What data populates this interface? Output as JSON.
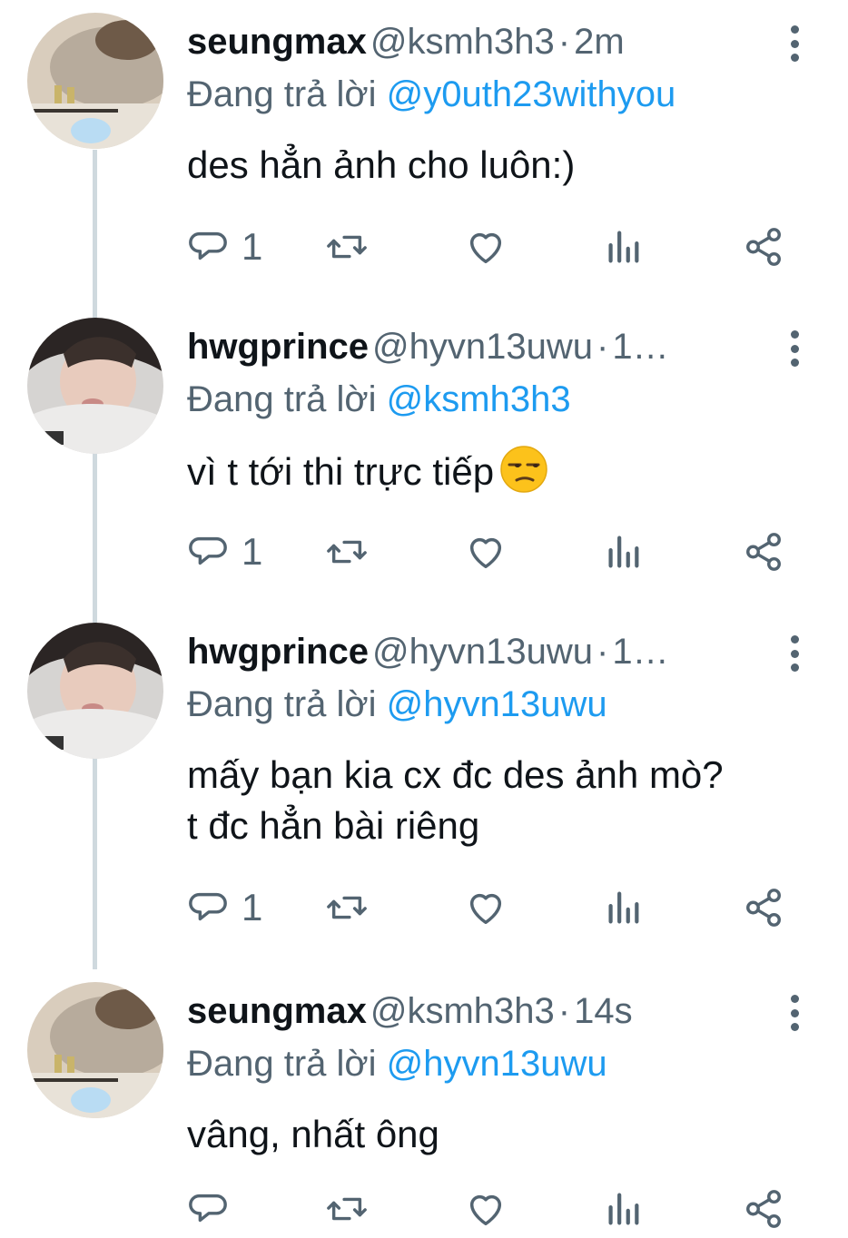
{
  "tweets": [
    {
      "name": "seungmax",
      "handle": "@ksmh3h3",
      "separator": "·",
      "time": "2m",
      "reply_prefix": "Đang trả lời",
      "reply_to": "@y0uth23withyou",
      "text_lines": [
        "des hẳn ảnh cho luôn:)"
      ],
      "reply_count": "1"
    },
    {
      "name": "hwgprince",
      "handle": "@hyvn13uwu",
      "separator": "·",
      "time": "1…",
      "reply_prefix": "Đang trả lời",
      "reply_to": "@ksmh3h3",
      "text_lines": [
        "vì t tới thi trực tiếp"
      ],
      "emoji": "unamused-face-emoji",
      "reply_count": "1"
    },
    {
      "name": "hwgprince",
      "handle": "@hyvn13uwu",
      "separator": "·",
      "time": "1…",
      "reply_prefix": "Đang trả lời",
      "reply_to": "@hyvn13uwu",
      "text_lines": [
        "mấy bạn kia cx đc des ảnh mò?",
        "t đc hẳn bài riêng"
      ],
      "reply_count": "1"
    },
    {
      "name": "seungmax",
      "handle": "@ksmh3h3",
      "separator": "·",
      "time": "14s",
      "reply_prefix": "Đang trả lời",
      "reply_to": "@hyvn13uwu",
      "text_lines": [
        "vâng, nhất ông"
      ],
      "reply_count": ""
    }
  ],
  "icons": {
    "reply": "reply-bubble-icon",
    "retweet": "retweet-icon",
    "like": "heart-icon",
    "views": "analytics-icon",
    "share": "share-icon",
    "more": "more-vertical-icon"
  },
  "colors": {
    "text": "#0f1419",
    "secondary": "#536471",
    "link": "#1d9bf0",
    "thread_line": "#cfd9de"
  }
}
